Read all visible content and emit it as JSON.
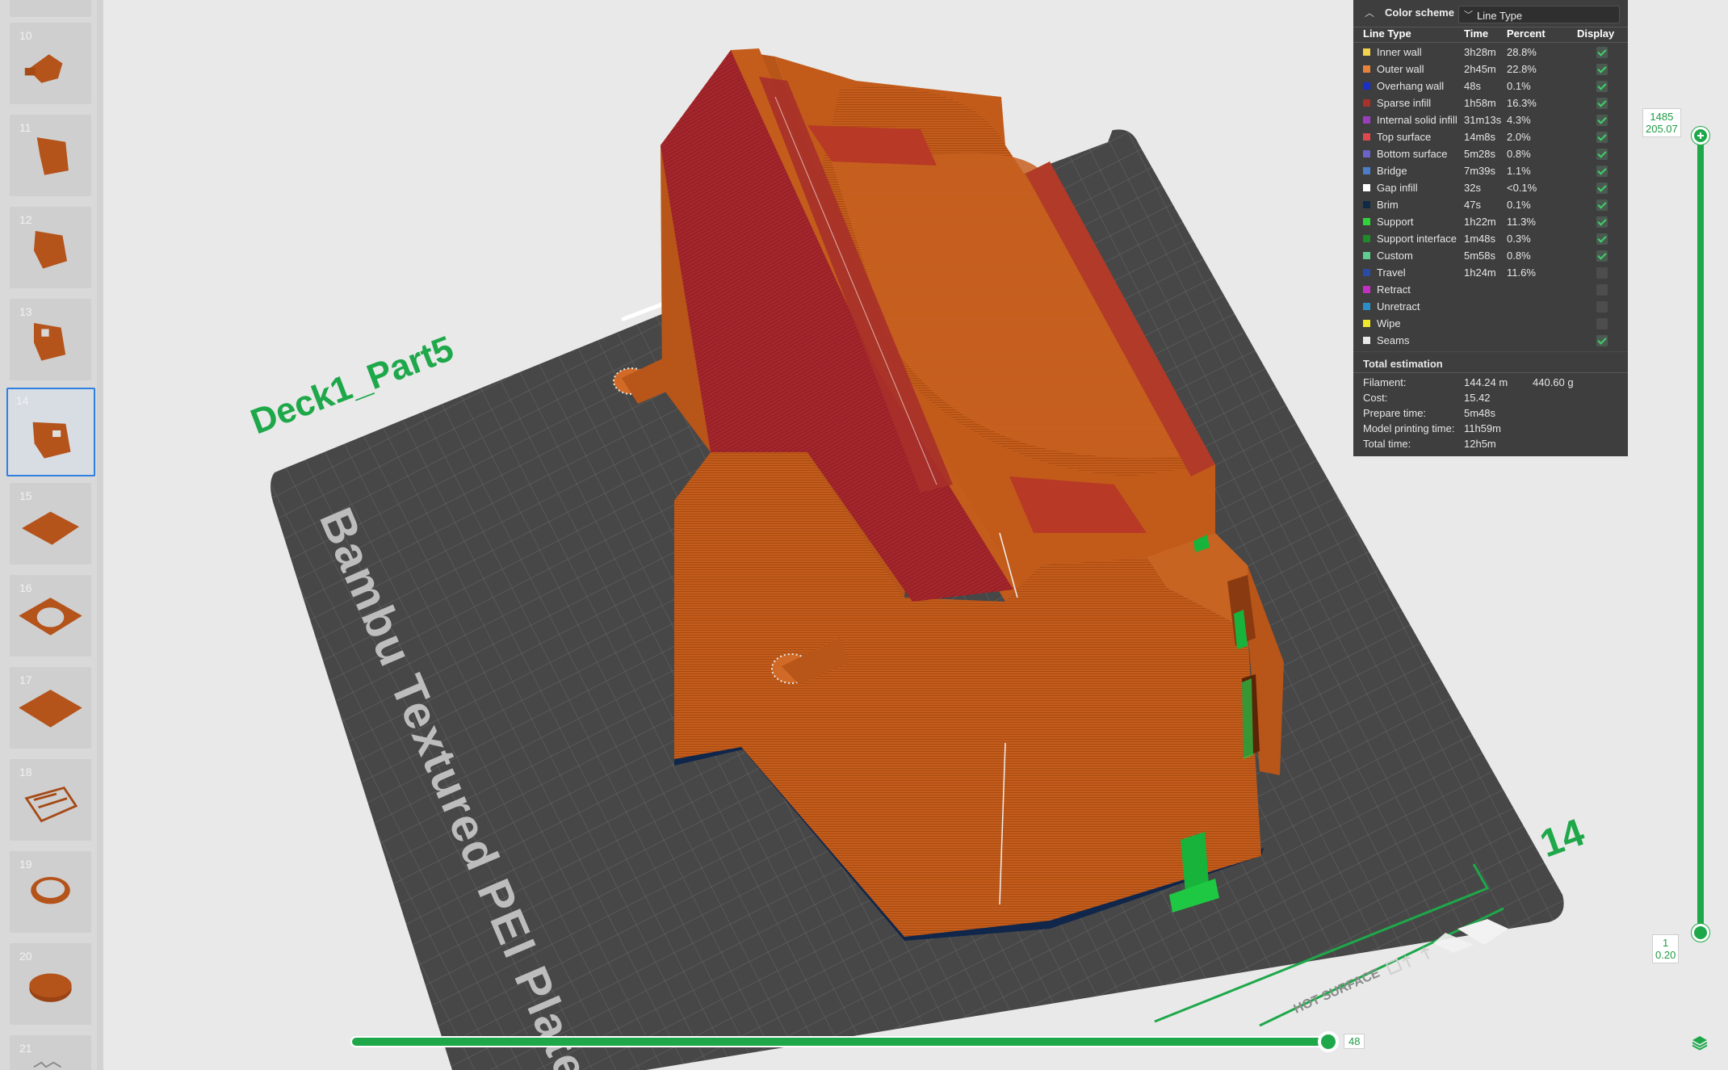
{
  "plates": [
    {
      "number": "10",
      "thumb_icon": "plate-thumbnail-icon"
    },
    {
      "number": "11",
      "thumb_icon": "plate-thumbnail-icon"
    },
    {
      "number": "12",
      "thumb_icon": "plate-thumbnail-icon"
    },
    {
      "number": "13",
      "thumb_icon": "plate-thumbnail-icon"
    },
    {
      "number": "14",
      "thumb_icon": "plate-thumbnail-icon",
      "selected": true
    },
    {
      "number": "15",
      "thumb_icon": "plate-thumbnail-icon"
    },
    {
      "number": "16",
      "thumb_icon": "plate-thumbnail-icon"
    },
    {
      "number": "17",
      "thumb_icon": "plate-thumbnail-icon"
    },
    {
      "number": "18",
      "thumb_icon": "plate-thumbnail-icon"
    },
    {
      "number": "19",
      "thumb_icon": "plate-thumbnail-icon"
    },
    {
      "number": "20",
      "thumb_icon": "plate-thumbnail-icon"
    },
    {
      "number": "21",
      "thumb_icon": "plate-thumbnail-icon"
    }
  ],
  "viewport": {
    "plate_name": "Deck1_Part5",
    "bed_label": "Bambu Textured PEI Plate",
    "plate_number": "14",
    "hot_surface_label": "HOT SURFACE",
    "model_color": "#c05a1a",
    "top_surface_color": "#a8282a",
    "support_color": "#18b33a",
    "brim_color": "#10264a",
    "bed_color": "#4a4a4a",
    "accent_color": "#1ea84a"
  },
  "legend": {
    "title": "Color scheme",
    "scheme_value": "Line Type",
    "headers": {
      "line_type": "Line Type",
      "time": "Time",
      "percent": "Percent",
      "display": "Display"
    },
    "rows": [
      {
        "label": "Inner wall",
        "time": "3h28m",
        "percent": "28.8%",
        "color": "#f2d24a",
        "display": true
      },
      {
        "label": "Outer wall",
        "time": "2h45m",
        "percent": "22.8%",
        "color": "#e8823a",
        "display": true
      },
      {
        "label": "Overhang wall",
        "time": "48s",
        "percent": "0.1%",
        "color": "#1a2fc8",
        "display": true
      },
      {
        "label": "Sparse infill",
        "time": "1h58m",
        "percent": "16.3%",
        "color": "#a8322a",
        "display": true
      },
      {
        "label": "Internal solid infill",
        "time": "31m13s",
        "percent": "4.3%",
        "color": "#9a3ec0",
        "display": true
      },
      {
        "label": "Top surface",
        "time": "14m8s",
        "percent": "2.0%",
        "color": "#e0484e",
        "display": true
      },
      {
        "label": "Bottom surface",
        "time": "5m28s",
        "percent": "0.8%",
        "color": "#6a63c8",
        "display": true
      },
      {
        "label": "Bridge",
        "time": "7m39s",
        "percent": "1.1%",
        "color": "#4a7ec8",
        "display": true
      },
      {
        "label": "Gap infill",
        "time": "32s",
        "percent": "<0.1%",
        "color": "#ffffff",
        "display": true
      },
      {
        "label": "Brim",
        "time": "47s",
        "percent": "0.1%",
        "color": "#0e2a44",
        "display": true
      },
      {
        "label": "Support",
        "time": "1h22m",
        "percent": "11.3%",
        "color": "#2ed43a",
        "display": true
      },
      {
        "label": "Support interface",
        "time": "1m48s",
        "percent": "0.3%",
        "color": "#1e8a2a",
        "display": true
      },
      {
        "label": "Custom",
        "time": "5m58s",
        "percent": "0.8%",
        "color": "#5ecf8e",
        "display": true
      },
      {
        "label": "Travel",
        "time": "1h24m",
        "percent": "11.6%",
        "color": "#2a4aa8",
        "display": false
      },
      {
        "label": "Retract",
        "time": "",
        "percent": "",
        "color": "#c42ec4",
        "display": false
      },
      {
        "label": "Unretract",
        "time": "",
        "percent": "",
        "color": "#2a8ec8",
        "display": false
      },
      {
        "label": "Wipe",
        "time": "",
        "percent": "",
        "color": "#f0e62a",
        "display": false
      },
      {
        "label": "Seams",
        "time": "",
        "percent": "",
        "color": "#e8e8e8",
        "display": true
      }
    ],
    "total_title": "Total estimation",
    "totals": [
      {
        "key": "Filament:",
        "value": "144.24 m",
        "value2": "440.60 g"
      },
      {
        "key": "Cost:",
        "value": "15.42",
        "value2": ""
      },
      {
        "key": "Prepare time:",
        "value": "5m48s",
        "value2": ""
      },
      {
        "key": "Model printing time:",
        "value": "11h59m",
        "value2": ""
      },
      {
        "key": "Total time:",
        "value": "12h5m",
        "value2": ""
      }
    ]
  },
  "layer_slider": {
    "top_layer": "1485",
    "top_height": "205.07",
    "bottom_layer": "1",
    "bottom_height": "0.20"
  },
  "move_slider": {
    "value": "48",
    "position_fraction": 1.0
  }
}
